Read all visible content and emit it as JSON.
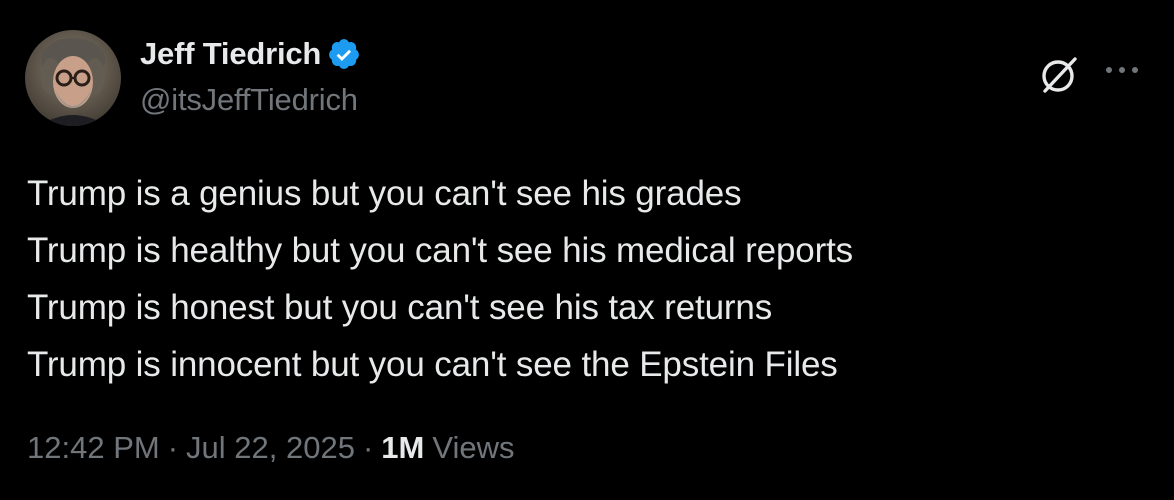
{
  "author": {
    "display_name": "Jeff Tiedrich",
    "handle": "@itsJeffTiedrich",
    "verified": true
  },
  "tweet": {
    "lines": [
      "Trump is a genius but you can't see his grades",
      "Trump is healthy but you can't see his medical reports",
      "Trump is honest but you can't see his tax returns",
      "Trump is innocent but you can't see the Epstein Files"
    ]
  },
  "meta": {
    "time": "12:42 PM",
    "separator": "·",
    "date": "Jul 22, 2025",
    "views_count": "1M",
    "views_label": "Views"
  },
  "icons": {
    "verified": "verified-badge-icon",
    "grok": "grok-icon",
    "more": "more-options-icon"
  },
  "colors": {
    "background": "#000000",
    "primary_text": "#e7e9ea",
    "secondary_text": "#71767b",
    "verified_blue": "#1d9bf0"
  }
}
